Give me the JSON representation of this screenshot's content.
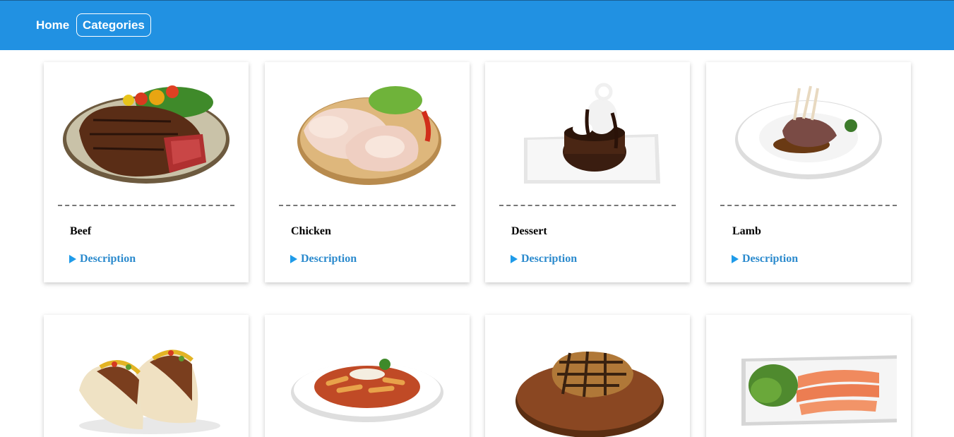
{
  "nav": {
    "home_label": "Home",
    "categories_label": "Categories"
  },
  "accent_color": "#2191e2",
  "description_label": "Description",
  "categories": [
    {
      "title": "Beef",
      "image": "beef-steak-image"
    },
    {
      "title": "Chicken",
      "image": "raw-chicken-image"
    },
    {
      "title": "Dessert",
      "image": "chocolate-cake-image"
    },
    {
      "title": "Lamb",
      "image": "lamb-rack-image"
    },
    {
      "title": "",
      "image": "tacos-image"
    },
    {
      "title": "",
      "image": "pasta-image"
    },
    {
      "title": "",
      "image": "pork-chop-image"
    },
    {
      "title": "",
      "image": "salmon-platter-image"
    }
  ]
}
